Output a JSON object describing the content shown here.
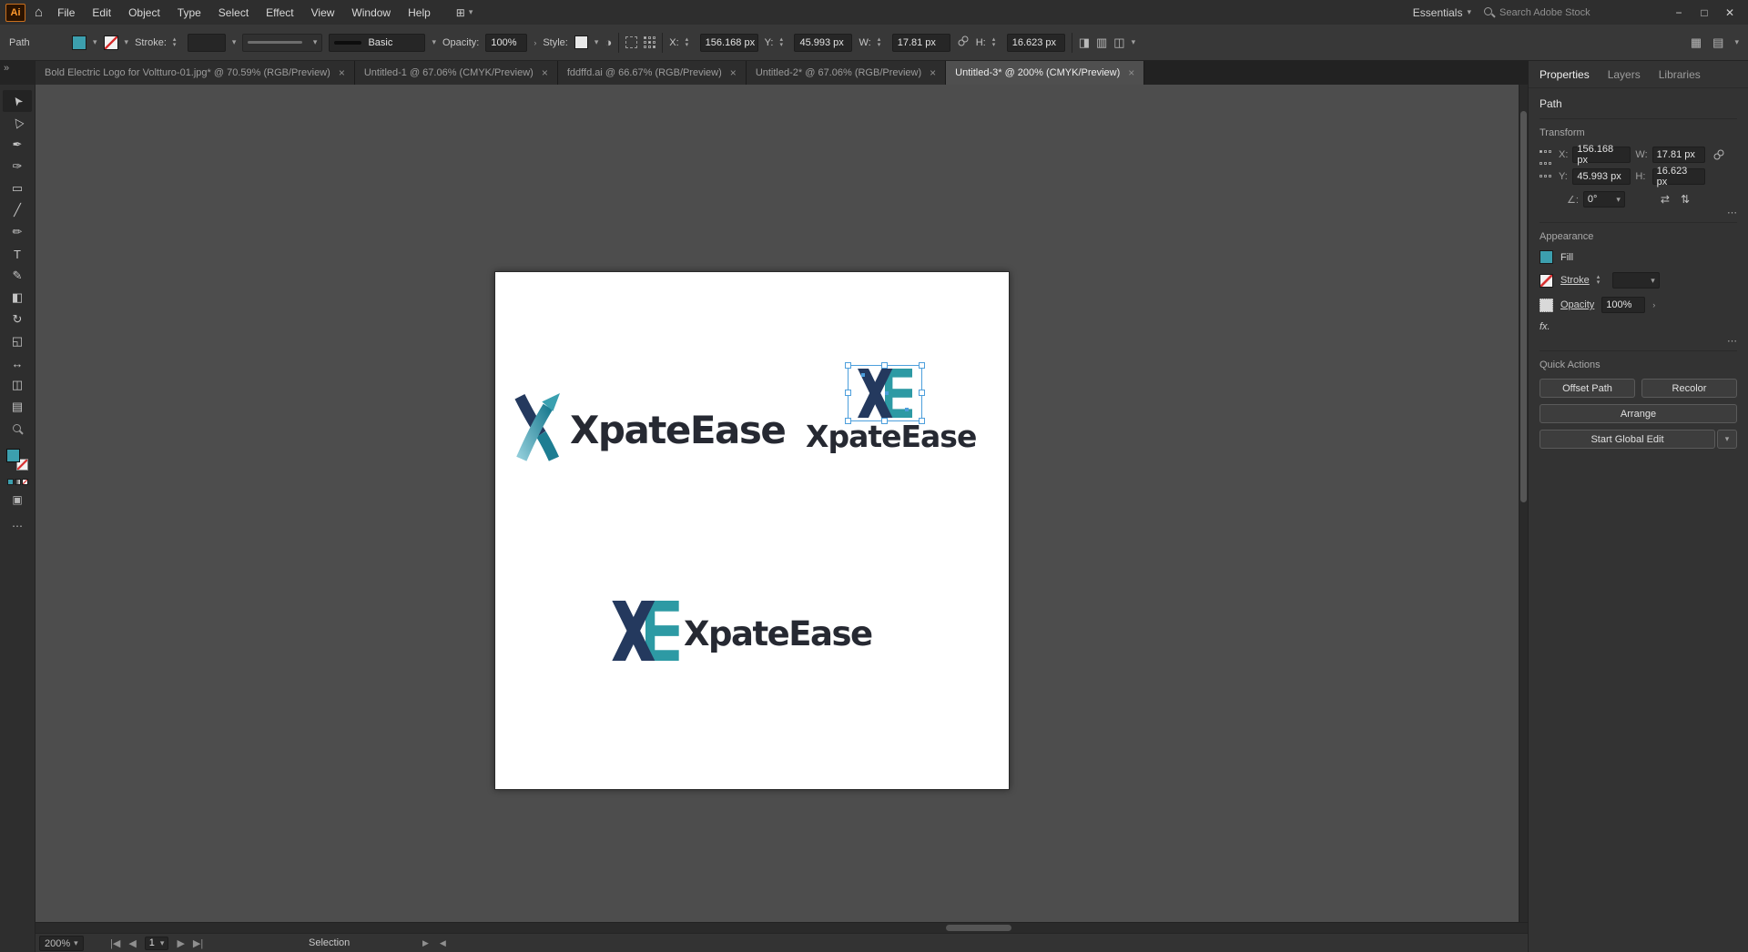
{
  "colors": {
    "fill": "#3C9FAE",
    "logo_navy": "#24395E",
    "logo_teal": "#2D9AA4",
    "logo_text": "#262932",
    "selection": "#4D9FDC"
  },
  "glyphs": {
    "chevron_down": "▾",
    "chevron_right": "›",
    "stepper_up": "▴",
    "stepper_down": "▾",
    "more": "⋯",
    "close": "×",
    "expand": "»",
    "home": "⌂",
    "workspace_grid": "⊞",
    "minimize": "−",
    "maximize": "□",
    "close_window": "✕",
    "angle": "∠:",
    "flip_h": "⇄",
    "flip_v": "⇅",
    "nav_first": "|◀",
    "nav_prev": "◀",
    "nav_next": "▶",
    "nav_last": "▶|",
    "doc_setup_circle": "◑",
    "arrange_docs": "▦",
    "list_view": "▤",
    "shape_mode": "◨",
    "align_strip": "▥",
    "pathfinder": "◫",
    "draw_mode": "▣"
  },
  "titlebar": {
    "app_icon": "Ai",
    "menus": [
      "File",
      "Edit",
      "Object",
      "Type",
      "Select",
      "Effect",
      "View",
      "Window",
      "Help"
    ],
    "workspace": "Essentials",
    "search_placeholder": "Search Adobe Stock"
  },
  "control_bar": {
    "selection_type": "Path",
    "stroke_label": "Stroke:",
    "brush_name": "Basic",
    "opacity_label": "Opacity:",
    "opacity_value": "100%",
    "style_label": "Style:",
    "x_label": "X:",
    "x_value": "156.168 px",
    "y_label": "Y:",
    "y_value": "45.993 px",
    "w_label": "W:",
    "w_value": "17.81 px",
    "h_label": "H:",
    "h_value": "16.623 px"
  },
  "document_tabs": [
    {
      "title": "Bold Electric Logo for Voltturo-01.jpg* @ 70.59% (RGB/Preview)"
    },
    {
      "title": "Untitled-1 @ 67.06% (CMYK/Preview)"
    },
    {
      "title": "fddffd.ai @ 66.67% (RGB/Preview)"
    },
    {
      "title": "Untitled-2* @ 67.06% (RGB/Preview)"
    },
    {
      "title": "Untitled-3* @ 200% (CMYK/Preview)"
    }
  ],
  "toolbar": {
    "tools": [
      {
        "name": "selection",
        "glyph": "➤"
      },
      {
        "name": "direct-selection",
        "glyph": "▷"
      },
      {
        "name": "pen",
        "glyph": "✒"
      },
      {
        "name": "curvature",
        "glyph": "✑"
      },
      {
        "name": "rectangle",
        "glyph": "▭"
      },
      {
        "name": "line-segment",
        "glyph": "╱"
      },
      {
        "name": "paintbrush",
        "glyph": "✏"
      },
      {
        "name": "type",
        "glyph": "T"
      },
      {
        "name": "pencil",
        "glyph": "✎"
      },
      {
        "name": "eraser",
        "glyph": "◧"
      },
      {
        "name": "rotate",
        "glyph": "↻"
      },
      {
        "name": "scale",
        "glyph": "◱"
      },
      {
        "name": "width",
        "glyph": "↔"
      },
      {
        "name": "shape-builder",
        "glyph": "◫"
      },
      {
        "name": "gradient",
        "glyph": "▤"
      }
    ]
  },
  "artboard": {
    "logo_text": "XpateEase"
  },
  "properties_panel": {
    "tabs": [
      "Properties",
      "Layers",
      "Libraries"
    ],
    "object_type": "Path",
    "transform": {
      "title": "Transform",
      "x_label": "X:",
      "x_value": "156.168 px",
      "y_label": "Y:",
      "y_value": "45.993 px",
      "w_label": "W:",
      "w_value": "17.81 px",
      "h_label": "H:",
      "h_value": "16.623 px",
      "angle_value": "0°"
    },
    "appearance": {
      "title": "Appearance",
      "fill_label": "Fill",
      "stroke_label": "Stroke",
      "opacity_label": "Opacity",
      "opacity_value": "100%",
      "fx_label": "fx."
    },
    "quick_actions": {
      "title": "Quick Actions",
      "offset_path": "Offset Path",
      "recolor": "Recolor",
      "arrange": "Arrange",
      "start_global_edit": "Start Global Edit"
    }
  },
  "status_bar": {
    "zoom": "200%",
    "artboard_number": "1",
    "status": "Selection"
  }
}
